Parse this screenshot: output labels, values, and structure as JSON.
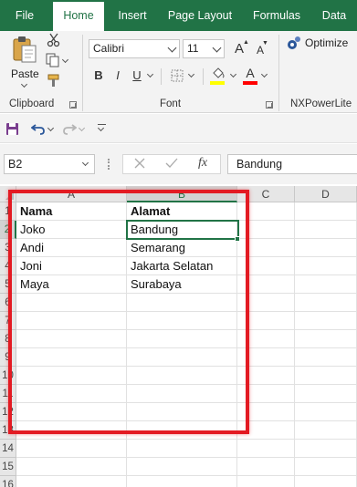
{
  "tabs": [
    "File",
    "Home",
    "Insert",
    "Page Layout",
    "Formulas",
    "Data"
  ],
  "active_tab": "Home",
  "ribbon": {
    "clipboard": {
      "paste_label": "Paste",
      "group_label": "Clipboard"
    },
    "font": {
      "font_name": "Calibri",
      "font_size": "11",
      "group_label": "Font",
      "bold": "B",
      "italic": "I",
      "underline": "U",
      "grow_font": "A",
      "shrink_font": "A",
      "font_color_letter": "A"
    },
    "addin": {
      "optimize_label": "Optimize",
      "group_label": "NXPowerLite"
    }
  },
  "formula_bar": {
    "name_box": "B2",
    "fx": "fx",
    "value": "Bandung"
  },
  "columns": [
    "A",
    "B",
    "C",
    "D"
  ],
  "rows": [
    "1",
    "2",
    "3",
    "4",
    "5",
    "6",
    "7",
    "8",
    "9",
    "10",
    "11",
    "12",
    "13",
    "14",
    "15",
    "16"
  ],
  "cells": {
    "headers": [
      "Nama",
      "Alamat"
    ],
    "data": [
      [
        "Joko",
        "Bandung"
      ],
      [
        "Andi",
        "Semarang"
      ],
      [
        "Joni",
        "Jakarta Selatan"
      ],
      [
        "Maya",
        "Surabaya"
      ]
    ]
  },
  "colors": {
    "accent": "#217346",
    "highlight": "#e31b23",
    "font_color": "#ff0000",
    "fill_color": "#ffff00"
  }
}
